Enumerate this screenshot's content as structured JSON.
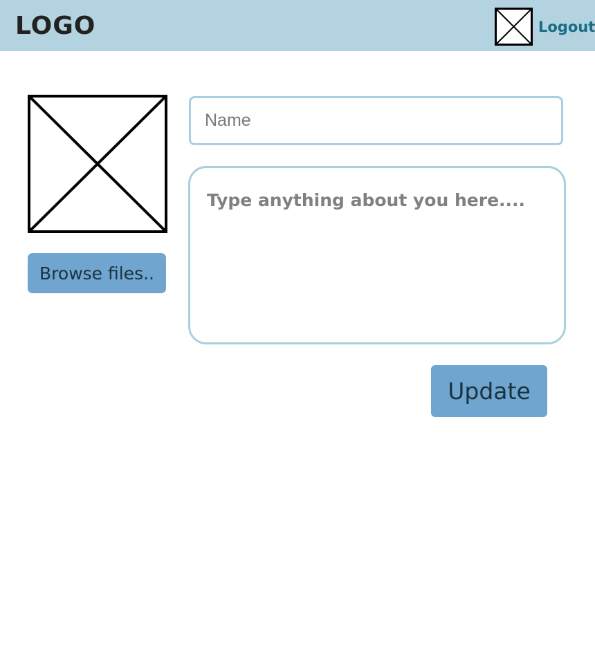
{
  "header": {
    "logo_text": "LOGO",
    "avatar_icon": "image-placeholder-icon",
    "logout_label": "Logout"
  },
  "profile": {
    "photo_icon": "image-placeholder-icon",
    "browse_label": "Browse files.."
  },
  "form": {
    "name_placeholder": "Name",
    "name_value": "",
    "about_placeholder": "Type anything about you here....",
    "about_value": "",
    "update_label": "Update"
  },
  "colors": {
    "header_bg": "#b2d3df",
    "button_bg": "#6fa5cf",
    "input_border": "#a9cfe0",
    "link": "#1a6b85"
  }
}
